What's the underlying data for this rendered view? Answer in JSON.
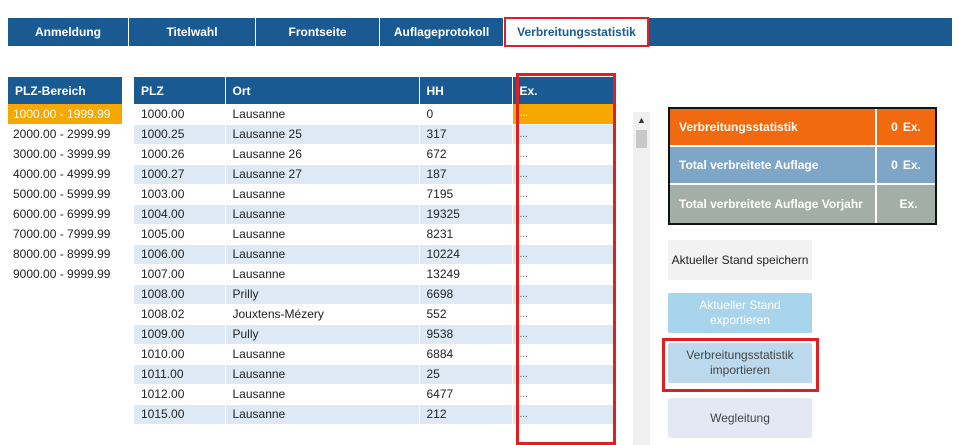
{
  "nav": {
    "tabs": [
      {
        "label": "Anmeldung",
        "active": false
      },
      {
        "label": "Titelwahl",
        "active": false
      },
      {
        "label": "Frontseite",
        "active": false
      },
      {
        "label": "Auflageprotokoll",
        "active": false
      },
      {
        "label": "Verbreitungsstatistik",
        "active": true
      }
    ]
  },
  "range_panel": {
    "header": "PLZ-Bereich",
    "items": [
      {
        "label": "1000.00 - 1999.99",
        "selected": true
      },
      {
        "label": "2000.00 - 2999.99",
        "selected": false
      },
      {
        "label": "3000.00 - 3999.99",
        "selected": false
      },
      {
        "label": "4000.00 - 4999.99",
        "selected": false
      },
      {
        "label": "5000.00 - 5999.99",
        "selected": false
      },
      {
        "label": "6000.00 - 6999.99",
        "selected": false
      },
      {
        "label": "7000.00 - 7999.99",
        "selected": false
      },
      {
        "label": "8000.00 - 8999.99",
        "selected": false
      },
      {
        "label": "9000.00 - 9999.99",
        "selected": false
      }
    ]
  },
  "table": {
    "columns": [
      "PLZ",
      "Ort",
      "HH",
      "Ex."
    ],
    "rows": [
      {
        "plz": "1000.00",
        "ort": "Lausanne",
        "hh": "0",
        "ex": "..."
      },
      {
        "plz": "1000.25",
        "ort": "Lausanne 25",
        "hh": "317",
        "ex": "..."
      },
      {
        "plz": "1000.26",
        "ort": "Lausanne 26",
        "hh": "672",
        "ex": "..."
      },
      {
        "plz": "1000.27",
        "ort": "Lausanne 27",
        "hh": "187",
        "ex": "..."
      },
      {
        "plz": "1003.00",
        "ort": "Lausanne",
        "hh": "7195",
        "ex": "..."
      },
      {
        "plz": "1004.00",
        "ort": "Lausanne",
        "hh": "19325",
        "ex": "..."
      },
      {
        "plz": "1005.00",
        "ort": "Lausanne",
        "hh": "8231",
        "ex": "..."
      },
      {
        "plz": "1006.00",
        "ort": "Lausanne",
        "hh": "10224",
        "ex": "..."
      },
      {
        "plz": "1007.00",
        "ort": "Lausanne",
        "hh": "13249",
        "ex": "..."
      },
      {
        "plz": "1008.00",
        "ort": "Prilly",
        "hh": "6698",
        "ex": "..."
      },
      {
        "plz": "1008.02",
        "ort": "Jouxtens-Mézery",
        "hh": "552",
        "ex": "..."
      },
      {
        "plz": "1009.00",
        "ort": "Pully",
        "hh": "9538",
        "ex": "..."
      },
      {
        "plz": "1010.00",
        "ort": "Lausanne",
        "hh": "6884",
        "ex": "..."
      },
      {
        "plz": "1011.00",
        "ort": "Lausanne",
        "hh": "25",
        "ex": "..."
      },
      {
        "plz": "1012.00",
        "ort": "Lausanne",
        "hh": "6477",
        "ex": "..."
      },
      {
        "plz": "1015.00",
        "ort": "Lausanne",
        "hh": "212",
        "ex": "..."
      }
    ]
  },
  "stats": {
    "rows": [
      {
        "label": "Verbreitungsstatistik",
        "value": "0",
        "unit": "Ex.",
        "color": "#f26a10"
      },
      {
        "label": "Total verbreitete Auflage",
        "value": "0",
        "unit": "Ex.",
        "color": "#7ea6c6"
      },
      {
        "label": "Total verbreitete Auflage Vorjahr",
        "value": "",
        "unit": "Ex.",
        "color": "#a4aea8"
      }
    ]
  },
  "buttons": {
    "save_label": "Aktueller Stand speichern",
    "export_label": "Aktueller Stand exportieren",
    "import_label": "Verbreitungsstatistik importieren",
    "help_label": "Wegleitung"
  },
  "colors": {
    "primary": "#1a5a92",
    "selected": "#f6a800",
    "highlight": "#e02020",
    "row_alt": "#dde9f5"
  }
}
